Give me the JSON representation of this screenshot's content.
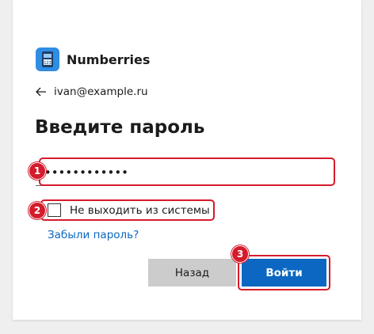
{
  "app": {
    "name": "Numberries",
    "icon": "numberries-app-icon",
    "icon_label": "123"
  },
  "account": {
    "email": "ivan@example.ru",
    "back_icon": "arrow-left-icon"
  },
  "title": "Введите пароль",
  "password": {
    "value": "•••••••••••••",
    "masked": true
  },
  "keep_signed_in": {
    "label": "Не выходить из системы",
    "checked": false
  },
  "forgot_link": "Забыли пароль?",
  "buttons": {
    "back": "Назад",
    "login": "Войти"
  },
  "markers": [
    "1",
    "2",
    "3"
  ],
  "colors": {
    "accent": "#0b67c2",
    "highlight": "#d41b2c",
    "secondary_button": "#cccccc",
    "app_icon": "#2f8de4",
    "background": "#efefef"
  }
}
